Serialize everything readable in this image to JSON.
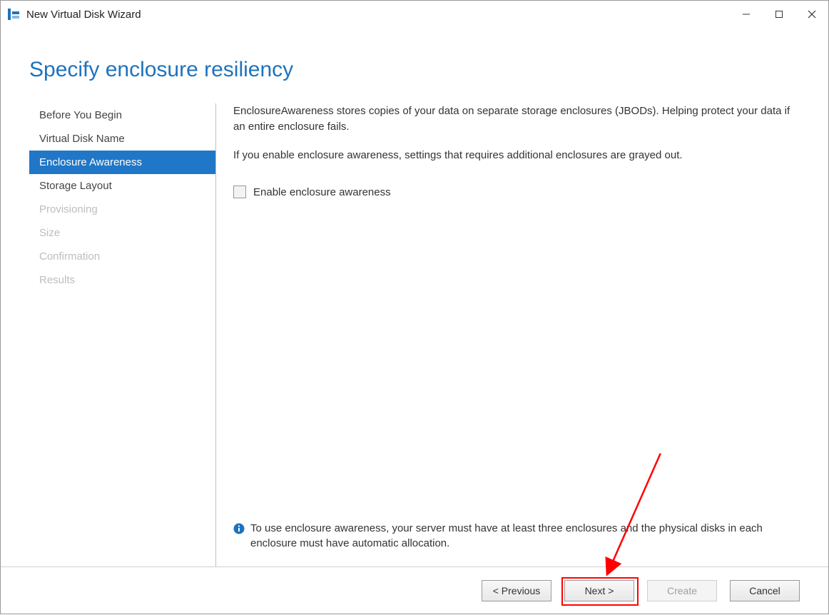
{
  "window": {
    "title": "New Virtual Disk Wizard"
  },
  "page": {
    "heading": "Specify enclosure resiliency"
  },
  "sidebar": {
    "items": [
      {
        "label": "Before You Begin",
        "state": "normal"
      },
      {
        "label": "Virtual Disk Name",
        "state": "normal"
      },
      {
        "label": "Enclosure Awareness",
        "state": "active"
      },
      {
        "label": "Storage Layout",
        "state": "normal"
      },
      {
        "label": "Provisioning",
        "state": "disabled"
      },
      {
        "label": "Size",
        "state": "disabled"
      },
      {
        "label": "Confirmation",
        "state": "disabled"
      },
      {
        "label": "Results",
        "state": "disabled"
      }
    ]
  },
  "main": {
    "description1": "EnclosureAwareness stores copies of your data on separate storage enclosures (JBODs). Helping protect your data if an entire enclosure fails.",
    "description2": "If you enable enclosure awareness, settings that requires additional enclosures are grayed out.",
    "checkbox_label": "Enable enclosure awareness",
    "checkbox_checked": false,
    "note": "To use enclosure awareness, your server must have at least three enclosures and the physical disks in each enclosure must have automatic allocation."
  },
  "buttons": {
    "previous": "< Previous",
    "next": "Next >",
    "create": "Create",
    "cancel": "Cancel"
  },
  "annotation": {
    "arrow_target": "next-button",
    "highlight_target": "next-button"
  },
  "colors": {
    "accent": "#1e73bd",
    "selection": "#2077c7",
    "annotation": "#ff0000"
  }
}
